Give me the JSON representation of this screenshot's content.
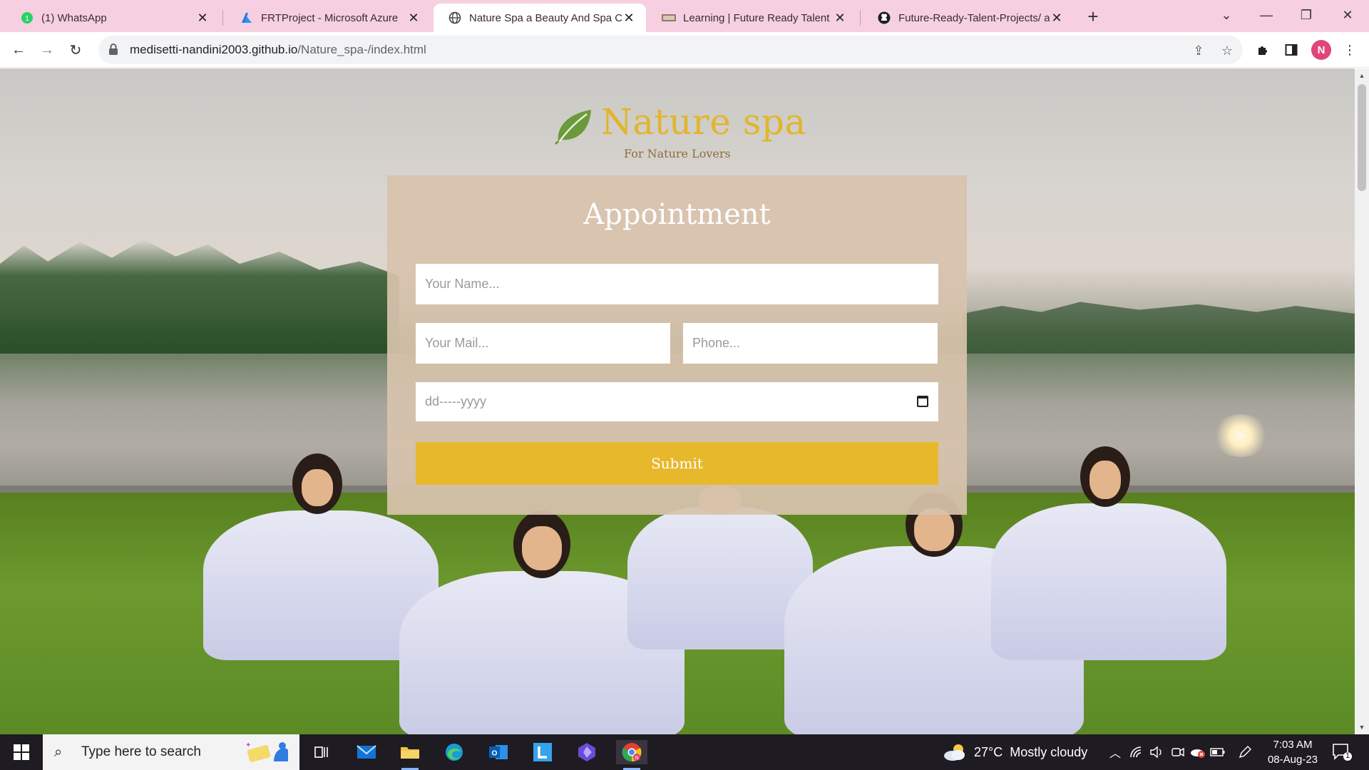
{
  "browser": {
    "tabs": [
      {
        "title": "(1) WhatsApp",
        "icon": "whatsapp-icon",
        "active": false
      },
      {
        "title": "FRTProject - Microsoft Azure",
        "icon": "azure-icon",
        "active": false
      },
      {
        "title": "Nature Spa a Beauty And Spa Ca",
        "icon": "globe-icon",
        "active": true
      },
      {
        "title": "Learning | Future Ready Talent",
        "icon": "learning-icon",
        "active": false
      },
      {
        "title": "Future-Ready-Talent-Projects/ at",
        "icon": "github-icon",
        "active": false
      }
    ],
    "url_host": "medisetti-nandini2003.github.io",
    "url_path": "/Nature_spa-/index.html",
    "profile_initial": "N"
  },
  "page": {
    "logo": {
      "brand": "Nature spa",
      "tagline": "For Nature Lovers"
    },
    "form": {
      "heading": "Appointment",
      "name_placeholder": "Your Name...",
      "mail_placeholder": "Your Mail...",
      "phone_placeholder": "Phone...",
      "date_placeholder": "dd-----yyyy",
      "submit_label": "Submit"
    }
  },
  "taskbar": {
    "search_placeholder": "Type here to search",
    "weather_temp": "27°C",
    "weather_desc": "Mostly cloudy",
    "time": "7:03 AM",
    "date": "08-Aug-23",
    "notification_count": "1"
  },
  "colors": {
    "tab_strip": "#f6cfe0",
    "brand_gold": "#e2b52b",
    "submit": "#e8b82c",
    "form_panel": "#d7c3ac"
  }
}
